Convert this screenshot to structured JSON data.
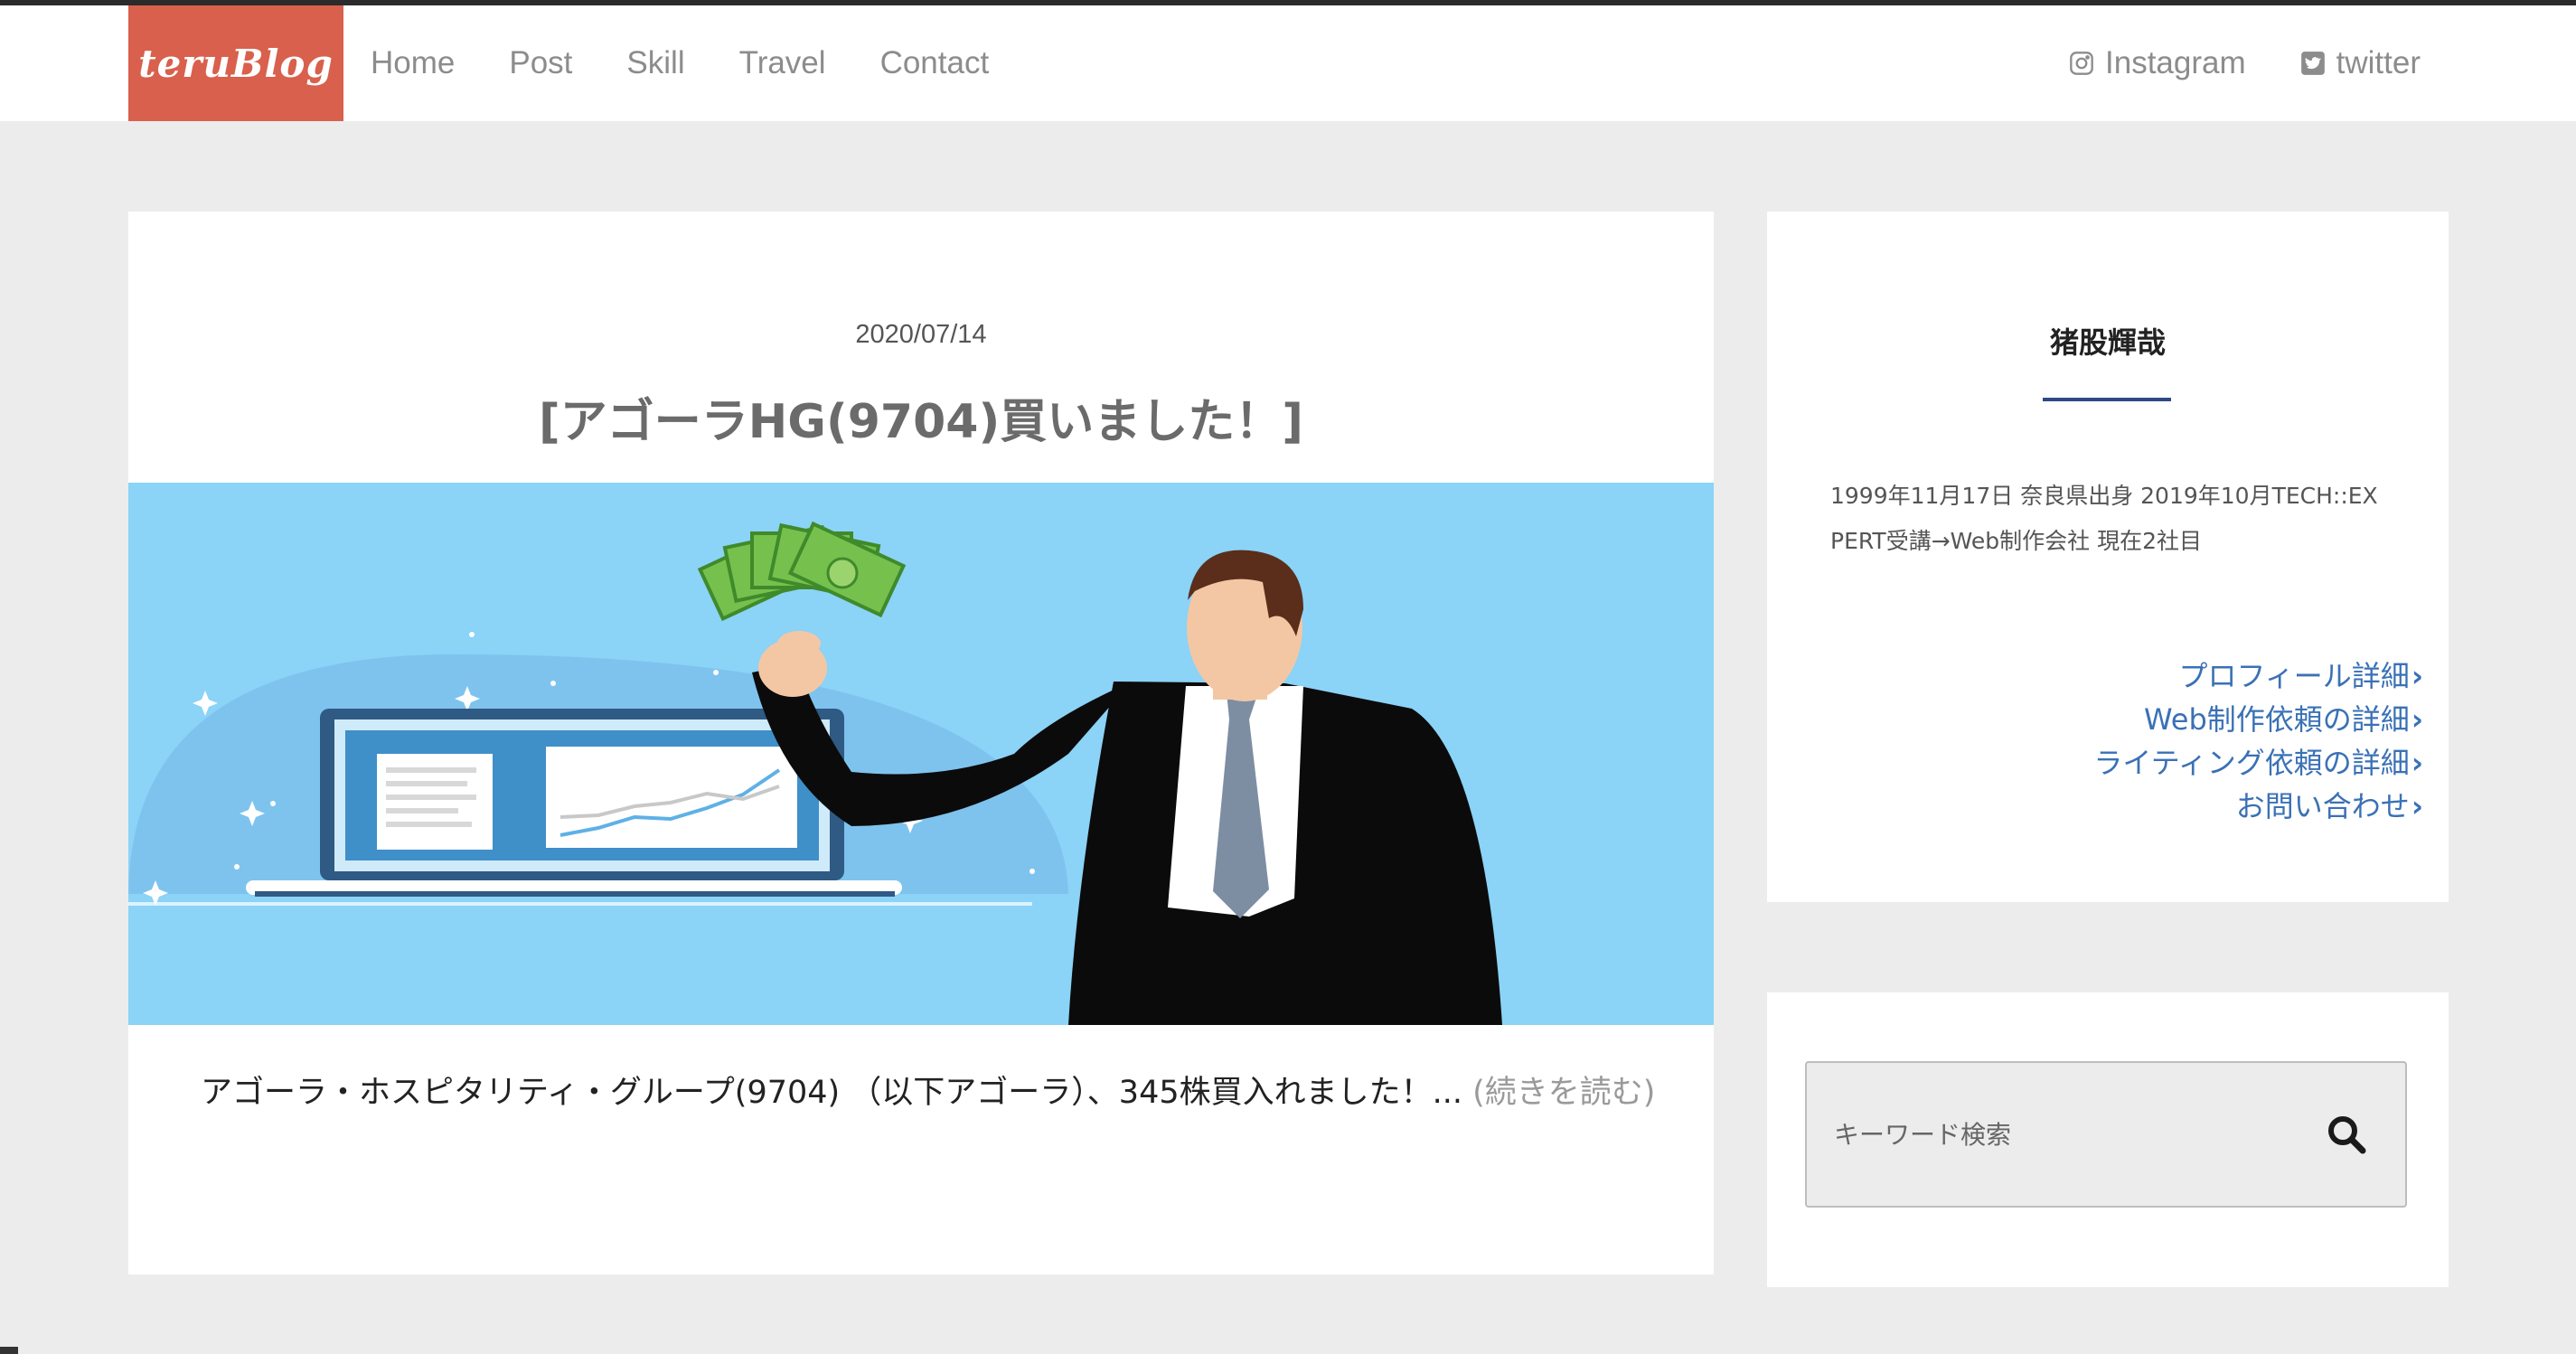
{
  "header": {
    "logo": "teruBlog",
    "nav": [
      "Home",
      "Post",
      "Skill",
      "Travel",
      "Contact"
    ],
    "social": [
      {
        "label": "Instagram",
        "icon": "instagram-icon"
      },
      {
        "label": "twitter",
        "icon": "twitter-icon"
      }
    ]
  },
  "article": {
    "date": "2020/07/14",
    "title": "[アゴーラHG(9704)買いました！]",
    "excerpt": "アゴーラ・ホスピタリティ・グループ(9704) （以下アゴーラ）、345株買入れました！... ",
    "more": "(続きを読む)"
  },
  "profile": {
    "name": "猪股輝哉",
    "desc_line1": "1999年11月17日 奈良県出身 2019年10月TECH::EX",
    "desc_line2": "PERT受講→Web制作会社 現在2社目",
    "links": [
      "プロフィール詳細",
      "Web制作依頼の詳細",
      "ライティング依頼の詳細",
      "お問い合わせ"
    ]
  },
  "search": {
    "placeholder": "キーワード検索"
  },
  "colors": {
    "logo_bg": "#d9604c",
    "link": "#3a71b6",
    "accent_line": "#2e4a86",
    "hero_bg": "#8bd3f7"
  }
}
